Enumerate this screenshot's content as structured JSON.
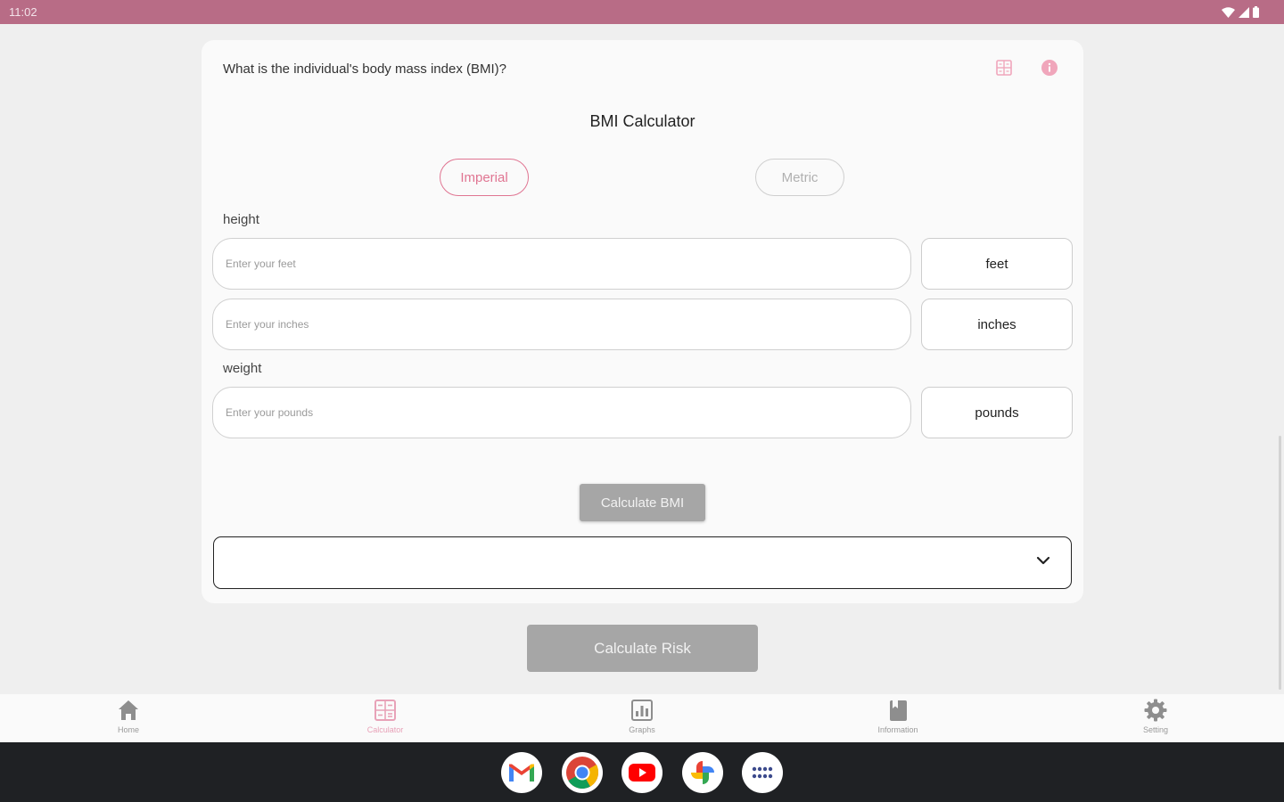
{
  "status_bar": {
    "time": "11:02"
  },
  "card": {
    "question": "What is the individual's body mass index (BMI)?",
    "title": "BMI Calculator",
    "unit_toggle": {
      "imperial": "Imperial",
      "metric": "Metric",
      "selected": "Imperial"
    },
    "height_label": "height",
    "weight_label": "weight",
    "feet_placeholder": "Enter your feet",
    "feet_unit": "feet",
    "inches_placeholder": "Enter your inches",
    "inches_unit": "inches",
    "pounds_placeholder": "Enter your pounds",
    "pounds_unit": "pounds",
    "calculate_bmi": "Calculate BMI",
    "bmi_dropdown_value": ""
  },
  "calculate_risk": "Calculate Risk",
  "bottom_nav": {
    "items": [
      {
        "label": "Home",
        "icon": "home-icon"
      },
      {
        "label": "Calculator",
        "icon": "calculator-icon"
      },
      {
        "label": "Graphs",
        "icon": "graph-icon"
      },
      {
        "label": "Information",
        "icon": "book-icon"
      },
      {
        "label": "Setting",
        "icon": "gear-icon"
      }
    ],
    "active": "Calculator"
  },
  "taskbar": {
    "apps": [
      "Gmail",
      "Chrome",
      "YouTube",
      "Photos",
      "App drawer"
    ]
  },
  "colors": {
    "status_bar": "#b86c86",
    "accent_pink": "#e07592",
    "button_disabled": "#a6a6a6",
    "taskbar": "#1f2124"
  }
}
